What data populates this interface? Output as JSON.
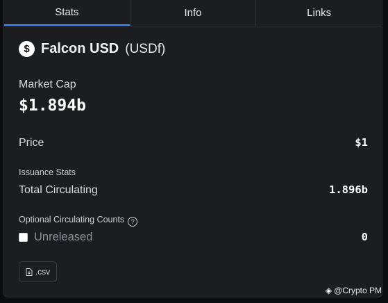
{
  "tabs": [
    {
      "label": "Stats",
      "active": true
    },
    {
      "label": "Info",
      "active": false
    },
    {
      "label": "Links",
      "active": false
    }
  ],
  "asset": {
    "icon_glyph": "$",
    "name": "Falcon USD",
    "symbol": "(USDf)"
  },
  "stats": {
    "market_cap_label": "Market Cap",
    "market_cap_value": "$1.894b",
    "price_label": "Price",
    "price_value": "$1",
    "issuance_title": "Issuance Stats",
    "total_circulating_label": "Total Circulating",
    "total_circulating_value": "1.896b",
    "optional_title": "Optional Circulating Counts",
    "unreleased_label": "Unreleased",
    "unreleased_value": "0",
    "unreleased_checked": false
  },
  "export": {
    "csv_label": ".csv"
  },
  "watermark": {
    "text": "@Crypto PM"
  },
  "colors": {
    "background": "#0b0c0e",
    "panel": "#1b1d21",
    "active_tab_accent": "#4a8cff"
  }
}
